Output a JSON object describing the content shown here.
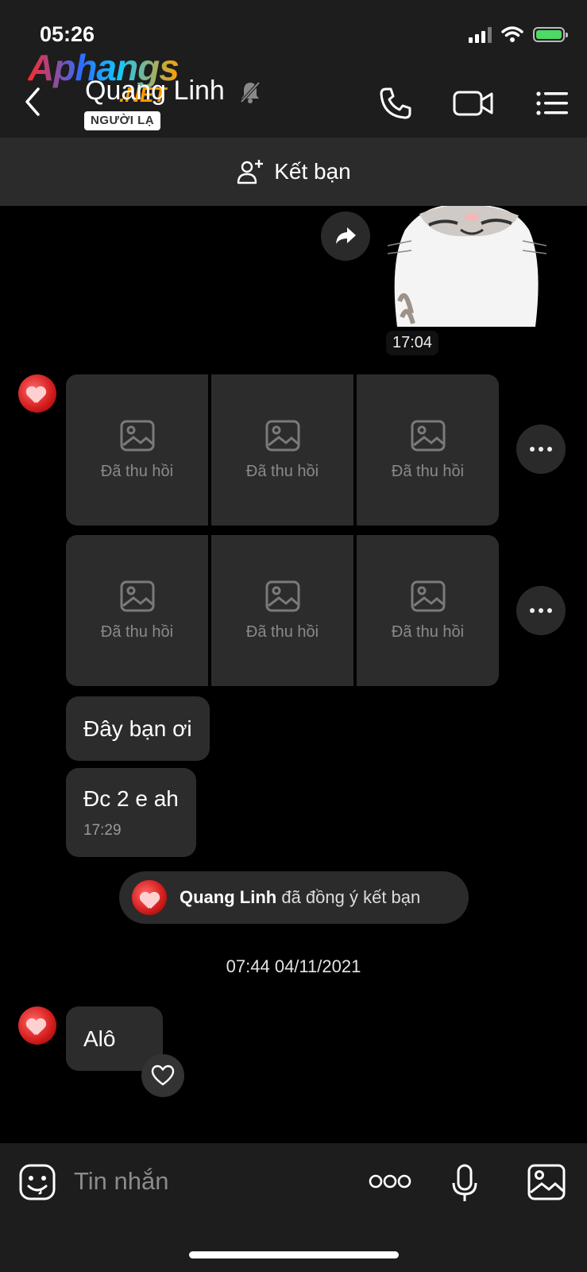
{
  "status_bar": {
    "time": "05:26"
  },
  "watermark": {
    "brand": "Aphangs",
    "suffix": ".NET"
  },
  "header": {
    "contact_name": "Quang Linh",
    "stranger_badge": "NGƯỜI LẠ",
    "icons": [
      "back-arrow-icon",
      "bell-off-icon",
      "phone-icon",
      "video-camera-icon",
      "menu-list-icon"
    ]
  },
  "add_friend": {
    "label": "Kết bạn",
    "icon": "add-person-icon"
  },
  "messages": {
    "sticker_time": "17:04",
    "recalled_label": "Đã thu hồi",
    "text_1": "Đây bạn ơi",
    "text_2": "Đc 2 e ah",
    "text_2_time": "17:29",
    "friend_notice_name": "Quang Linh",
    "friend_notice_text": "đã đồng ý kết bạn",
    "date_separator": "07:44 04/11/2021",
    "text_3": "Alô"
  },
  "input": {
    "placeholder": "Tin nhắn",
    "icons": [
      "emoji-icon",
      "more-options-icon",
      "microphone-icon",
      "image-icon"
    ]
  },
  "colors": {
    "background": "#000000",
    "header_bg": "#1d1d1d",
    "bubble_bg": "#2c2c2c",
    "battery_green": "#4cd964"
  }
}
